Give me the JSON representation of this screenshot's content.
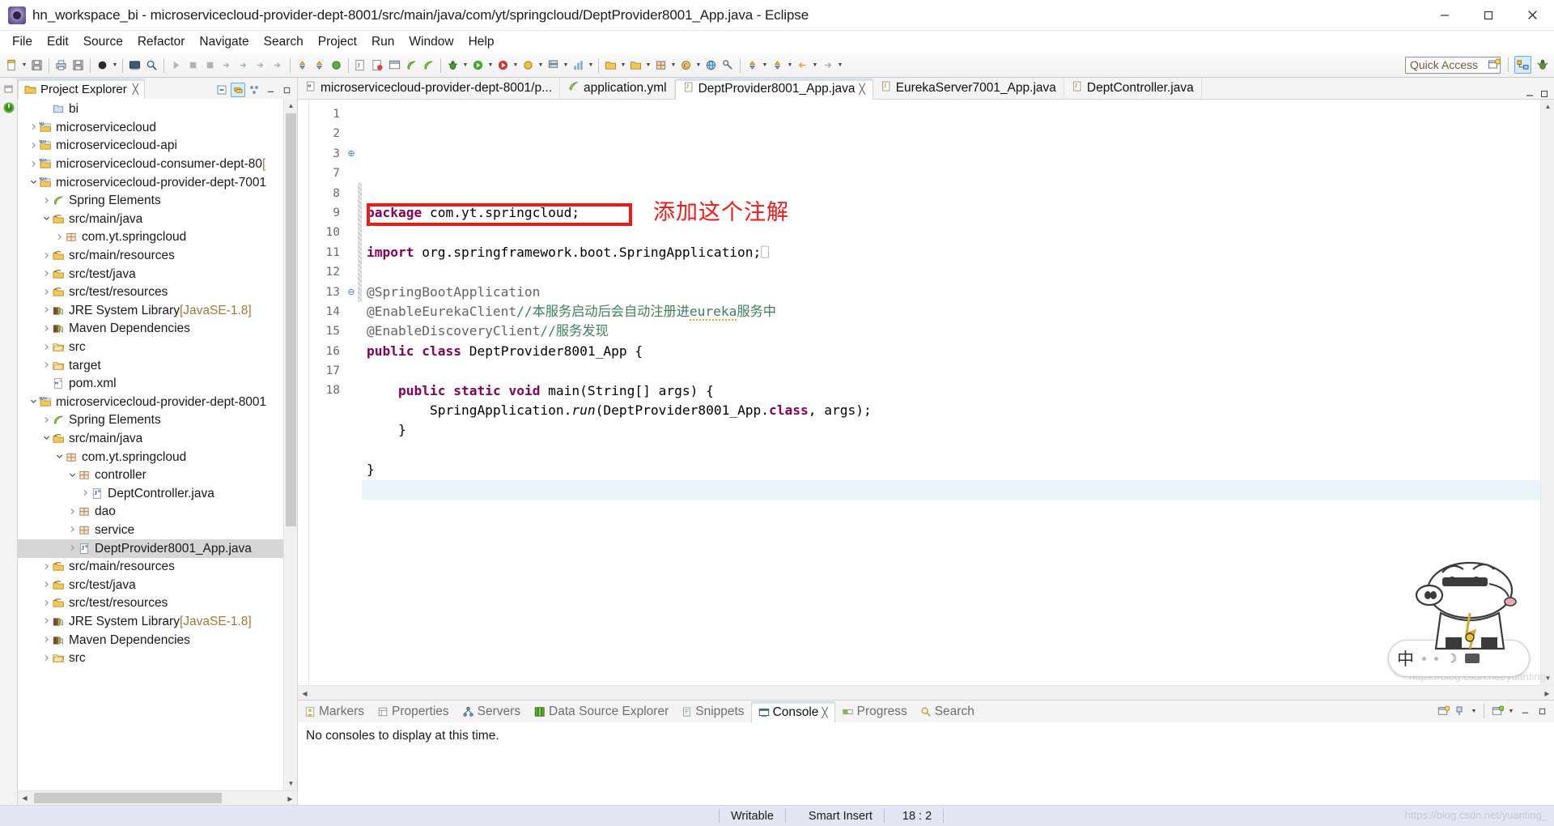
{
  "window": {
    "title": "hn_workspace_bi - microservicecloud-provider-dept-8001/src/main/java/com/yt/springcloud/DeptProvider8001_App.java - Eclipse",
    "minimize": "–",
    "maximize": "❐",
    "close": "✕"
  },
  "menubar": {
    "items": [
      {
        "label": "File"
      },
      {
        "label": "Edit"
      },
      {
        "label": "Source"
      },
      {
        "label": "Refactor"
      },
      {
        "label": "Navigate"
      },
      {
        "label": "Search"
      },
      {
        "label": "Project"
      },
      {
        "label": "Run"
      },
      {
        "label": "Window"
      },
      {
        "label": "Help"
      }
    ]
  },
  "toolbar": {
    "quick_access_placeholder": "Quick Access",
    "quick_access_value": ""
  },
  "explorer": {
    "tab_label": "Project Explorer",
    "tab_close": "╳",
    "tools": [
      "collapse-all-icon",
      "link-with-editor-icon",
      "view-menu-icon",
      "minimize-icon",
      "maximize-icon"
    ],
    "tree": [
      {
        "indent": 1,
        "twisty": "",
        "icon": "folder",
        "label": "bi",
        "dim": ""
      },
      {
        "indent": 0,
        "twisty": "›",
        "icon": "maven-m2",
        "label": "microservicecloud",
        "dim": ""
      },
      {
        "indent": 0,
        "twisty": "›",
        "icon": "maven-j",
        "label": "microservicecloud-api",
        "dim": ""
      },
      {
        "indent": 0,
        "twisty": "›",
        "icon": "maven-s",
        "label": "microservicecloud-consumer-dept-80",
        "dim": "["
      },
      {
        "indent": 0,
        "twisty": "⌄",
        "icon": "maven-s",
        "label": "microservicecloud-provider-dept-7001",
        "dim": ""
      },
      {
        "indent": 1,
        "twisty": "›",
        "icon": "spring",
        "label": "Spring Elements",
        "dim": ""
      },
      {
        "indent": 1,
        "twisty": "⌄",
        "icon": "srcfolder",
        "label": "src/main/java",
        "dim": ""
      },
      {
        "indent": 2,
        "twisty": "›",
        "icon": "package",
        "label": "com.yt.springcloud",
        "dim": ""
      },
      {
        "indent": 1,
        "twisty": "›",
        "icon": "srcfolder",
        "label": "src/main/resources",
        "dim": ""
      },
      {
        "indent": 1,
        "twisty": "›",
        "icon": "srcfolder",
        "label": "src/test/java",
        "dim": ""
      },
      {
        "indent": 1,
        "twisty": "›",
        "icon": "srcfolder",
        "label": "src/test/resources",
        "dim": ""
      },
      {
        "indent": 1,
        "twisty": "›",
        "icon": "library",
        "label": "JRE System Library ",
        "dim": "[JavaSE-1.8]"
      },
      {
        "indent": 1,
        "twisty": "›",
        "icon": "library",
        "label": "Maven Dependencies",
        "dim": ""
      },
      {
        "indent": 1,
        "twisty": "›",
        "icon": "folder2",
        "label": "src",
        "dim": ""
      },
      {
        "indent": 1,
        "twisty": "›",
        "icon": "folder2",
        "label": "target",
        "dim": ""
      },
      {
        "indent": 1,
        "twisty": "",
        "icon": "xmlfile",
        "label": "pom.xml",
        "dim": ""
      },
      {
        "indent": 0,
        "twisty": "⌄",
        "icon": "maven-s",
        "label": "microservicecloud-provider-dept-8001",
        "dim": ""
      },
      {
        "indent": 1,
        "twisty": "›",
        "icon": "spring",
        "label": "Spring Elements",
        "dim": ""
      },
      {
        "indent": 1,
        "twisty": "⌄",
        "icon": "srcfolder",
        "label": "src/main/java",
        "dim": ""
      },
      {
        "indent": 2,
        "twisty": "⌄",
        "icon": "package",
        "label": "com.yt.springcloud",
        "dim": ""
      },
      {
        "indent": 3,
        "twisty": "⌄",
        "icon": "package",
        "label": "controller",
        "dim": ""
      },
      {
        "indent": 4,
        "twisty": "›",
        "icon": "javafile",
        "label": "DeptController.java",
        "dim": ""
      },
      {
        "indent": 3,
        "twisty": "›",
        "icon": "package",
        "label": "dao",
        "dim": ""
      },
      {
        "indent": 3,
        "twisty": "›",
        "icon": "package",
        "label": "service",
        "dim": ""
      },
      {
        "indent": 3,
        "twisty": "›",
        "icon": "javafile",
        "label": "DeptProvider8001_App.java",
        "dim": "",
        "selected": true
      },
      {
        "indent": 1,
        "twisty": "›",
        "icon": "srcfolder",
        "label": "src/main/resources",
        "dim": ""
      },
      {
        "indent": 1,
        "twisty": "›",
        "icon": "srcfolder",
        "label": "src/test/java",
        "dim": ""
      },
      {
        "indent": 1,
        "twisty": "›",
        "icon": "srcfolder",
        "label": "src/test/resources",
        "dim": ""
      },
      {
        "indent": 1,
        "twisty": "›",
        "icon": "library",
        "label": "JRE System Library ",
        "dim": "[JavaSE-1.8]"
      },
      {
        "indent": 1,
        "twisty": "›",
        "icon": "library",
        "label": "Maven Dependencies",
        "dim": ""
      },
      {
        "indent": 1,
        "twisty": "›",
        "icon": "folder2",
        "label": "src",
        "dim": ""
      }
    ]
  },
  "editor": {
    "tabs": [
      {
        "label": "microservicecloud-provider-dept-8001/p...",
        "icon": "xml-icon",
        "active": false,
        "closable": false
      },
      {
        "label": "application.yml",
        "icon": "yml-icon",
        "active": false,
        "closable": false
      },
      {
        "label": "DeptProvider8001_App.java",
        "icon": "java-icon",
        "active": true,
        "closable": true,
        "close": "╳"
      },
      {
        "label": "EurekaServer7001_App.java",
        "icon": "java-icon",
        "active": false,
        "closable": false
      },
      {
        "label": "DeptController.java",
        "icon": "java-icon",
        "active": false,
        "closable": false
      }
    ],
    "lines": [
      {
        "no": "1",
        "fold": "",
        "html": "<span class=\"kw\">package</span> com.yt.springcloud;"
      },
      {
        "no": "2",
        "fold": "",
        "html": ""
      },
      {
        "no": "3",
        "fold": "⊕",
        "html": "<span class=\"kw\">import</span> org.springframework.boot.SpringApplication;<span style=\"color:#b0b0b0\">⎕</span>"
      },
      {
        "no": "7",
        "fold": "",
        "html": ""
      },
      {
        "no": "8",
        "fold": "",
        "html": "<span class=\"ann\">@SpringBootApplication</span>"
      },
      {
        "no": "9",
        "fold": "",
        "html": "<span class=\"ann\">@EnableEurekaClient</span><span class=\"cmt\">//本服务启动后会自动注册进<span class=\"squiggle\">eureka</span>服务中</span>"
      },
      {
        "no": "10",
        "fold": "",
        "html": "<span class=\"ann\">@EnableDiscoveryClient</span><span class=\"cmt\">//服务发现</span>"
      },
      {
        "no": "11",
        "fold": "",
        "html": "<span class=\"kw\">public</span> <span class=\"kw\">class</span> DeptProvider8001_App {"
      },
      {
        "no": "12",
        "fold": "",
        "html": ""
      },
      {
        "no": "13",
        "fold": "⊖",
        "html": "    <span class=\"kw\">public</span> <span class=\"kw\">static</span> <span class=\"kw\">void</span> main(String[] args) {"
      },
      {
        "no": "14",
        "fold": "",
        "html": "        SpringApplication.<span class=\"ital\">run</span>(DeptProvider8001_App.<span class=\"kw\">class</span>, args);"
      },
      {
        "no": "15",
        "fold": "",
        "html": "    }"
      },
      {
        "no": "16",
        "fold": "",
        "html": ""
      },
      {
        "no": "17",
        "fold": "",
        "html": "}"
      },
      {
        "no": "18",
        "fold": "",
        "html": "",
        "current": true
      }
    ],
    "annotation": {
      "text": "添加这个注解",
      "color": "#ee1b1b"
    },
    "watermark": "https://blog.csdn.net/yuanting"
  },
  "bottom": {
    "tabs": [
      {
        "label": "Markers",
        "icon": "markers-icon",
        "active": false
      },
      {
        "label": "Properties",
        "icon": "properties-icon",
        "active": false
      },
      {
        "label": "Servers",
        "icon": "servers-icon",
        "active": false
      },
      {
        "label": "Data Source Explorer",
        "icon": "datasource-icon",
        "active": false
      },
      {
        "label": "Snippets",
        "icon": "snippets-icon",
        "active": false
      },
      {
        "label": "Console",
        "icon": "console-icon",
        "active": true,
        "close": "╳"
      },
      {
        "label": "Progress",
        "icon": "progress-icon",
        "active": false
      },
      {
        "label": "Search",
        "icon": "search-icon",
        "active": false
      }
    ],
    "console_message": "No consoles to display at this time."
  },
  "statusbar": {
    "writable": "Writable",
    "insert_mode": "Smart Insert",
    "position": "18 : 2",
    "watermark": "https://blog.csdn.net/yuanting_"
  },
  "ime": {
    "lang": "中",
    "moon": "☽"
  },
  "colors": {
    "accent": "#ee1b1b",
    "keyword": "#7f0055",
    "comment": "#3f7f5f",
    "annotation": "#646464",
    "selection": "#d6d6d6",
    "current_line": "#eaf2fb",
    "statusbar_bg": "#e4e6f3"
  }
}
